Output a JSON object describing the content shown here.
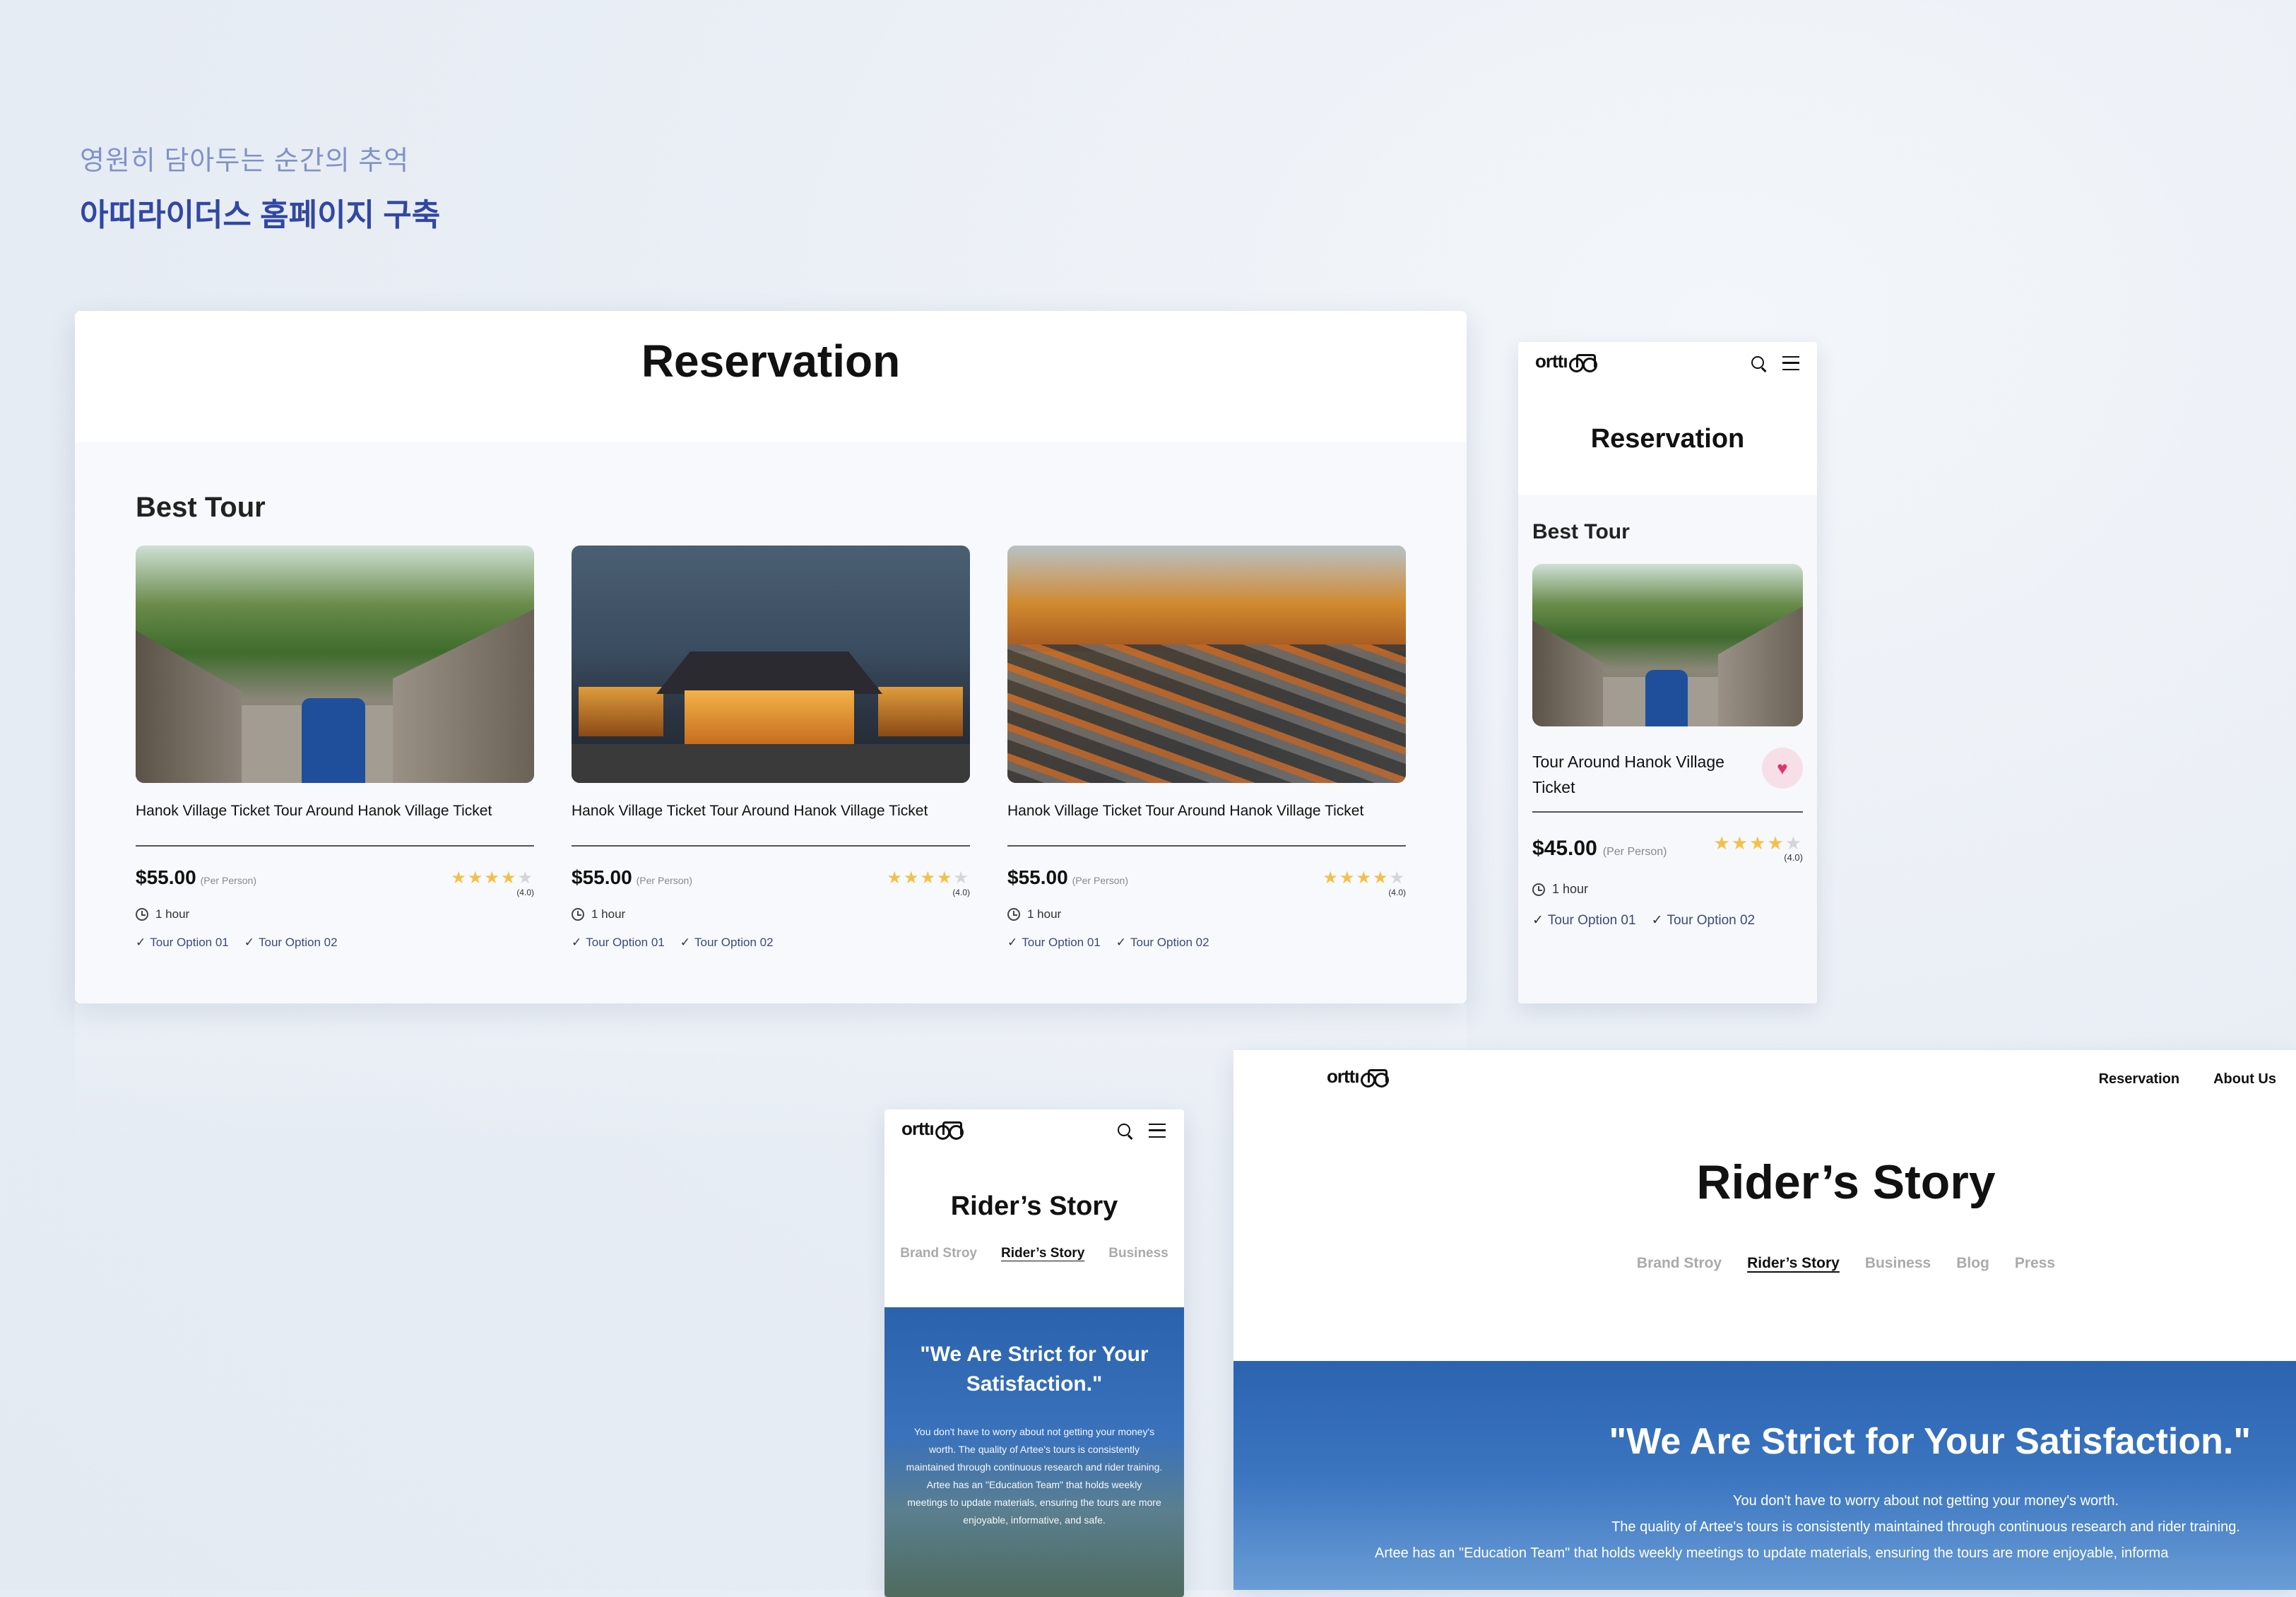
{
  "intro": {
    "kicker": "영원히 담아두는 순간의 추억",
    "headline": "아띠라이더스 홈페이지 구축"
  },
  "reservation_desktop": {
    "title": "Reservation",
    "section_title": "Best Tour",
    "cards": [
      {
        "name": "Hanok Village Ticket Tour Around Hanok Village Ticket",
        "price": "$55.00",
        "per": "(Per Person)",
        "rating": "(4.0)",
        "stars": 4,
        "duration": "1 hour",
        "options": [
          "Tour Option 01",
          "Tour Option 02"
        ],
        "image": "hanok-village-street"
      },
      {
        "name": "Hanok Village Ticket Tour Around Hanok Village Ticket",
        "price": "$55.00",
        "per": "(Per Person)",
        "rating": "(4.0)",
        "stars": 4,
        "duration": "1 hour",
        "options": [
          "Tour Option 01",
          "Tour Option 02"
        ],
        "image": "palace-night"
      },
      {
        "name": "Hanok Village Ticket Tour Around Hanok Village Ticket",
        "price": "$55.00",
        "per": "(Per Person)",
        "rating": "(4.0)",
        "stars": 4,
        "duration": "1 hour",
        "options": [
          "Tour Option 01",
          "Tour Option 02"
        ],
        "image": "palace-aerial-autumn"
      }
    ]
  },
  "reservation_mobile": {
    "logo": "orttı",
    "title": "Reservation",
    "section_title": "Best Tour",
    "card": {
      "name": "Tour Around Hanok Village Ticket",
      "price": "$45.00",
      "per": "(Per Person)",
      "rating": "(4.0)",
      "stars": 4,
      "duration": "1 hour",
      "options": [
        "Tour Option 01",
        "Tour Option 02"
      ],
      "favorite": true
    }
  },
  "story_mobile": {
    "logo": "orttı",
    "title": "Rider’s Story",
    "tabs": [
      "Brand Stroy",
      "Rider’s Story",
      "Business"
    ],
    "active_tab": "Rider’s Story",
    "quote": "\"We Are Strict for Your Satisfaction.\"",
    "paragraph": "You don't have to worry about not getting your money's worth. The quality of Artee's tours is consistently maintained through continuous research and rider training. Artee has an \"Education Team\" that holds weekly meetings to update materials, ensuring the tours are more enjoyable, informative, and safe."
  },
  "story_desktop": {
    "logo": "orttı",
    "nav": [
      "Reservation",
      "About Us"
    ],
    "title": "Rider’s Story",
    "tabs": [
      "Brand Stroy",
      "Rider’s Story",
      "Business",
      "Blog",
      "Press"
    ],
    "active_tab": "Rider’s Story",
    "quote": "\"We Are Strict for Your Satisfaction.\"",
    "lines": [
      "You don't have to worry about not getting your money's worth.",
      "The quality of Artee's tours is consistently maintained through continuous research and rider training.",
      "Artee has an \"Education Team\" that holds weekly meetings to update materials, ensuring the tours are more enjoyable, informa"
    ]
  },
  "colors": {
    "accent": "#3147a3",
    "kicker": "#8192c8",
    "star": "#f3c04a",
    "heart": "#e0356d",
    "hero_blue": "#2b63b0"
  }
}
